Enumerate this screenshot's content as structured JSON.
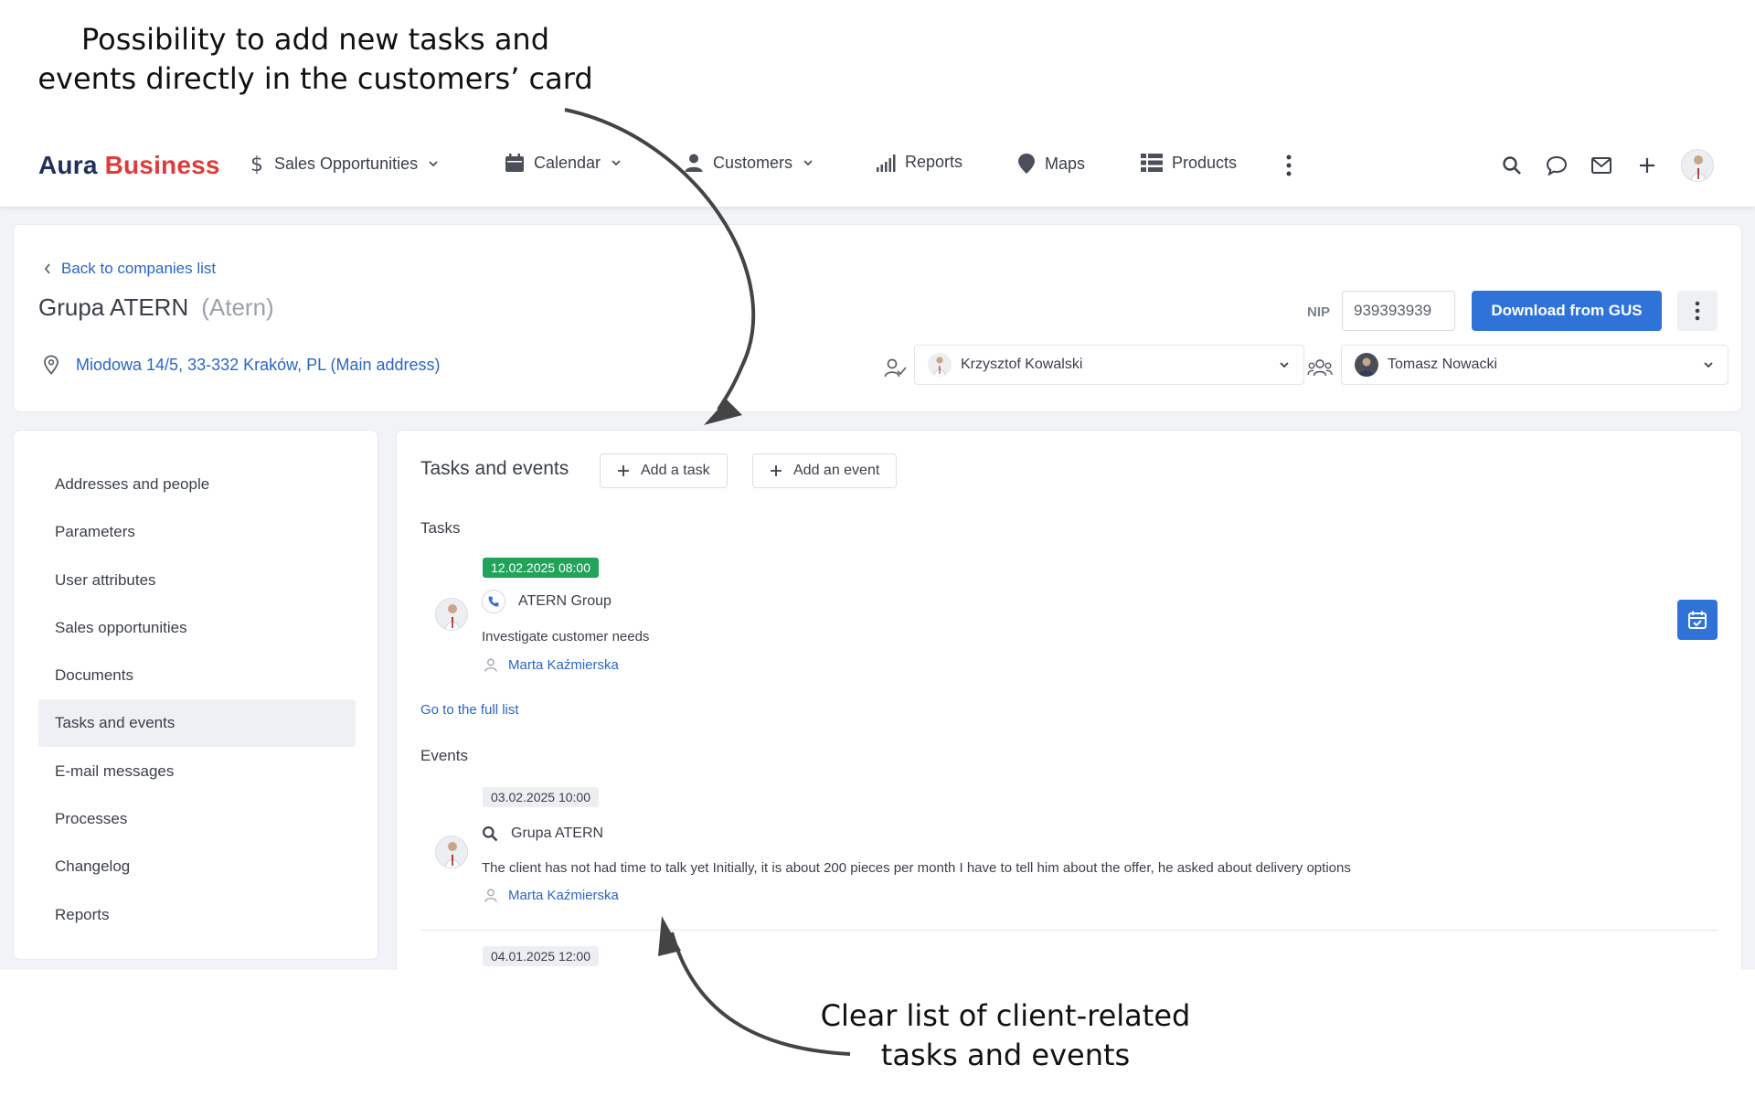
{
  "annotations": {
    "top_line1": "Possibility to add new tasks and",
    "top_line2": "events directly in the customers’ card",
    "bottom_line1": "Clear list of client-related",
    "bottom_line2": "tasks and events"
  },
  "brand": {
    "part1": "Aura",
    "part2": "Business",
    "color_primary": "#1d2f5a",
    "color_accent": "#e03a3a"
  },
  "nav": {
    "items": [
      {
        "label": "Sales Opportunities",
        "icon": "dollar-icon",
        "dropdown": true
      },
      {
        "label": "Calendar",
        "icon": "calendar-icon",
        "dropdown": true
      },
      {
        "label": "Customers",
        "icon": "user-icon",
        "dropdown": true
      },
      {
        "label": "Reports",
        "icon": "bar-chart-icon",
        "dropdown": false
      },
      {
        "label": "Maps",
        "icon": "map-pin-icon",
        "dropdown": false
      },
      {
        "label": "Products",
        "icon": "grid-list-icon",
        "dropdown": false
      }
    ],
    "right_icons": [
      "search-icon",
      "chat-icon",
      "mail-icon",
      "plus-icon",
      "avatar"
    ]
  },
  "header": {
    "back_label": "Back to companies list",
    "company_name": "Grupa ATERN",
    "company_alias": "(Atern)",
    "address": "Miodowa 14/5, 33-332 Kraków, PL (Main address)",
    "nip_label": "NIP",
    "nip_value": "939393939",
    "download_label": "Download from GUS",
    "owner": "Krzysztof Kowalski",
    "team_member": "Tomasz Nowacki",
    "button_color": "#2f73d8"
  },
  "sidebar": {
    "items": [
      {
        "label": "Addresses and people",
        "active": false
      },
      {
        "label": "Parameters",
        "active": false
      },
      {
        "label": "User attributes",
        "active": false
      },
      {
        "label": "Sales opportunities",
        "active": false
      },
      {
        "label": "Documents",
        "active": false
      },
      {
        "label": "Tasks and events",
        "active": true
      },
      {
        "label": "E-mail messages",
        "active": false
      },
      {
        "label": "Processes",
        "active": false
      },
      {
        "label": "Changelog",
        "active": false
      },
      {
        "label": "Reports",
        "active": false
      }
    ]
  },
  "main": {
    "title": "Tasks and events",
    "add_task_label": "Add a task",
    "add_event_label": "Add an event",
    "tasks_label": "Tasks",
    "task": {
      "date": "12.02.2025 08:00",
      "company": "ATERN Group",
      "description": "Investigate customer needs",
      "person": "Marta Kaźmierska",
      "badge_color": "#22a35a"
    },
    "full_list_label": "Go to the full list",
    "events_label": "Events",
    "events": [
      {
        "date": "03.02.2025 10:00",
        "company": "Grupa ATERN",
        "description": "The client has not had time to talk yet Initially, it is about 200 pieces per month I have to tell him about the offer, he asked about delivery options",
        "person": "Marta Kaźmierska"
      },
      {
        "date": "04.01.2025 12:00"
      }
    ]
  }
}
